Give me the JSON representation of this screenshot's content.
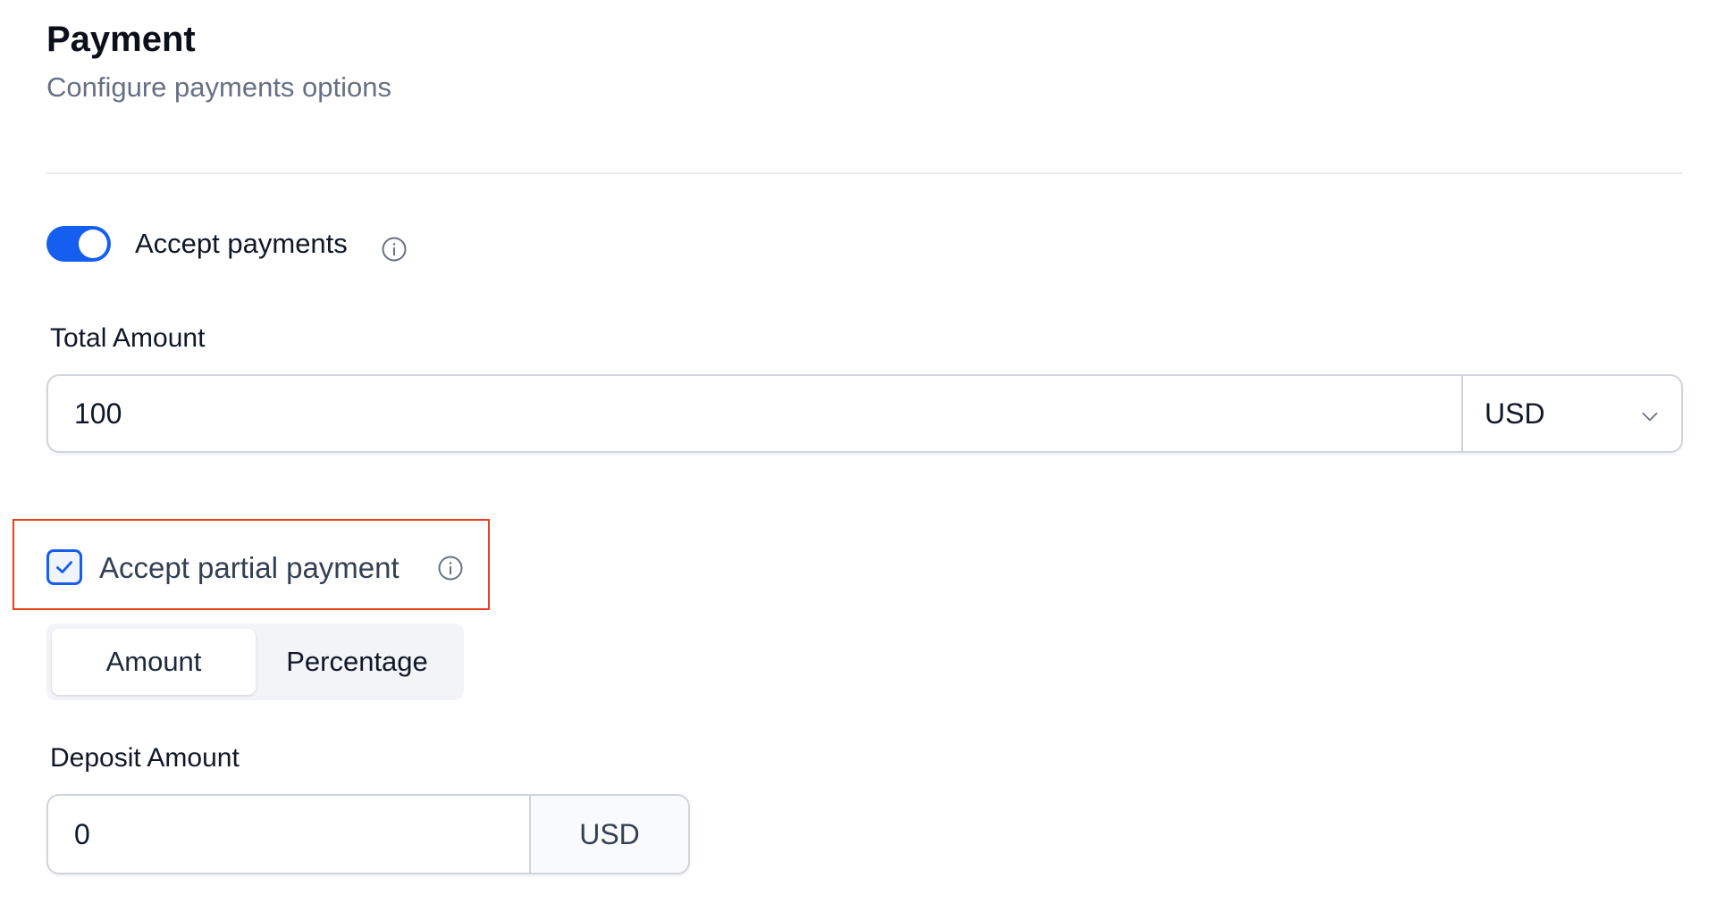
{
  "header": {
    "title": "Payment",
    "subtitle": "Configure payments options"
  },
  "accept_payments": {
    "label": "Accept payments",
    "enabled": true,
    "info_icon": "info-circle-icon"
  },
  "total_amount": {
    "label": "Total Amount",
    "value": "100",
    "currency": "USD",
    "currency_icon": "chevron-down-icon"
  },
  "partial_payment": {
    "label": "Accept partial payment",
    "checked": true,
    "info_icon": "info-circle-icon"
  },
  "deposit_mode": {
    "options": [
      "Amount",
      "Percentage"
    ],
    "selected": "Amount"
  },
  "deposit_amount": {
    "label": "Deposit Amount",
    "value": "0",
    "currency": "USD"
  },
  "colors": {
    "accent": "#155eef",
    "highlight": "#e5431e",
    "muted_text": "#667085",
    "border": "#d0d5dd"
  }
}
